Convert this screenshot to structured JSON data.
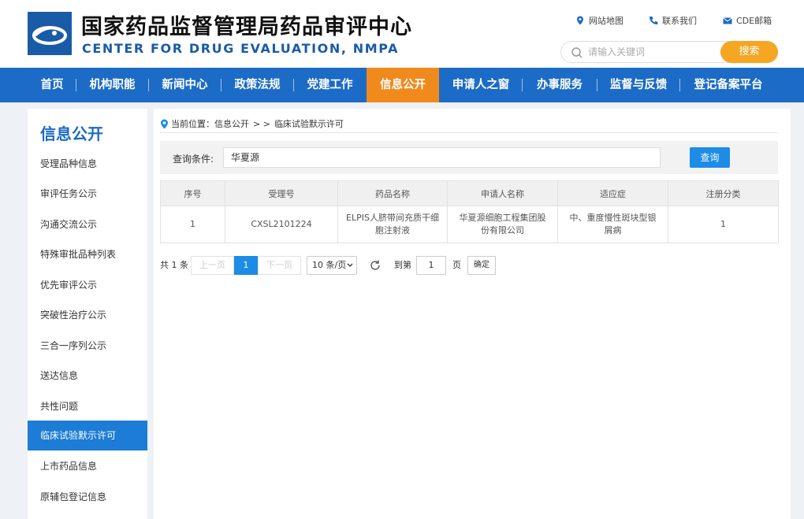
{
  "header": {
    "title_cn": "国家药品监督管理局药品审评中心",
    "title_en": "CENTER FOR DRUG EVALUATION, NMPA",
    "top_links": [
      {
        "label": "网站地图",
        "icon": "map-pin-icon"
      },
      {
        "label": "联系我们",
        "icon": "phone-icon"
      },
      {
        "label": "CDE邮箱",
        "icon": "mail-icon"
      }
    ],
    "search": {
      "placeholder": "请输入关键词",
      "button": "搜索"
    }
  },
  "nav": {
    "items": [
      {
        "label": "首页"
      },
      {
        "label": "机构职能"
      },
      {
        "label": "新闻中心"
      },
      {
        "label": "政策法规"
      },
      {
        "label": "党建工作"
      },
      {
        "label": "信息公开"
      },
      {
        "label": "申请人之窗"
      },
      {
        "label": "办事服务"
      },
      {
        "label": "监督与反馈"
      },
      {
        "label": "登记备案平台"
      }
    ],
    "active": "信息公开"
  },
  "sidebar": {
    "title": "信息公开",
    "items": [
      {
        "label": "受理品种信息"
      },
      {
        "label": "审评任务公示"
      },
      {
        "label": "沟通交流公示"
      },
      {
        "label": "特殊审批品种列表"
      },
      {
        "label": "优先审评公示"
      },
      {
        "label": "突破性治疗公示"
      },
      {
        "label": "三合一序列公示"
      },
      {
        "label": "送达信息"
      },
      {
        "label": "共性问题"
      },
      {
        "label": "临床试验默示许可"
      },
      {
        "label": "上市药品信息"
      },
      {
        "label": "原辅包登记信息"
      }
    ],
    "active": "临床试验默示许可"
  },
  "breadcrumb": {
    "prefix": "当前位置：",
    "section": "信息公开",
    "separator": "> >",
    "current": "临床试验默示许可"
  },
  "query": {
    "label": "查询条件:",
    "value": "华夏源",
    "button": "查询"
  },
  "table": {
    "headers": [
      "序号",
      "受理号",
      "药品名称",
      "申请人名称",
      "适应症",
      "注册分类"
    ],
    "rows": [
      [
        "1",
        "CXSL2101224",
        "ELPIS人脐带间充质干细胞注射液",
        "华夏源细胞工程集团股份有限公司",
        "中、重度慢性斑块型银屑病",
        "1"
      ]
    ]
  },
  "pager": {
    "total": "共 1 条",
    "prev": "上一页",
    "current_page": "1",
    "next": "下一页",
    "page_size": "10 条/页",
    "goto_label": "到第",
    "goto_value": "1",
    "page_unit": "页",
    "confirm": "确定"
  },
  "colors": {
    "brand_blue": "#1c6bc6",
    "active_orange": "#f08a1d",
    "search_orange": "#f5a623",
    "button_blue": "#1c8ce6"
  }
}
